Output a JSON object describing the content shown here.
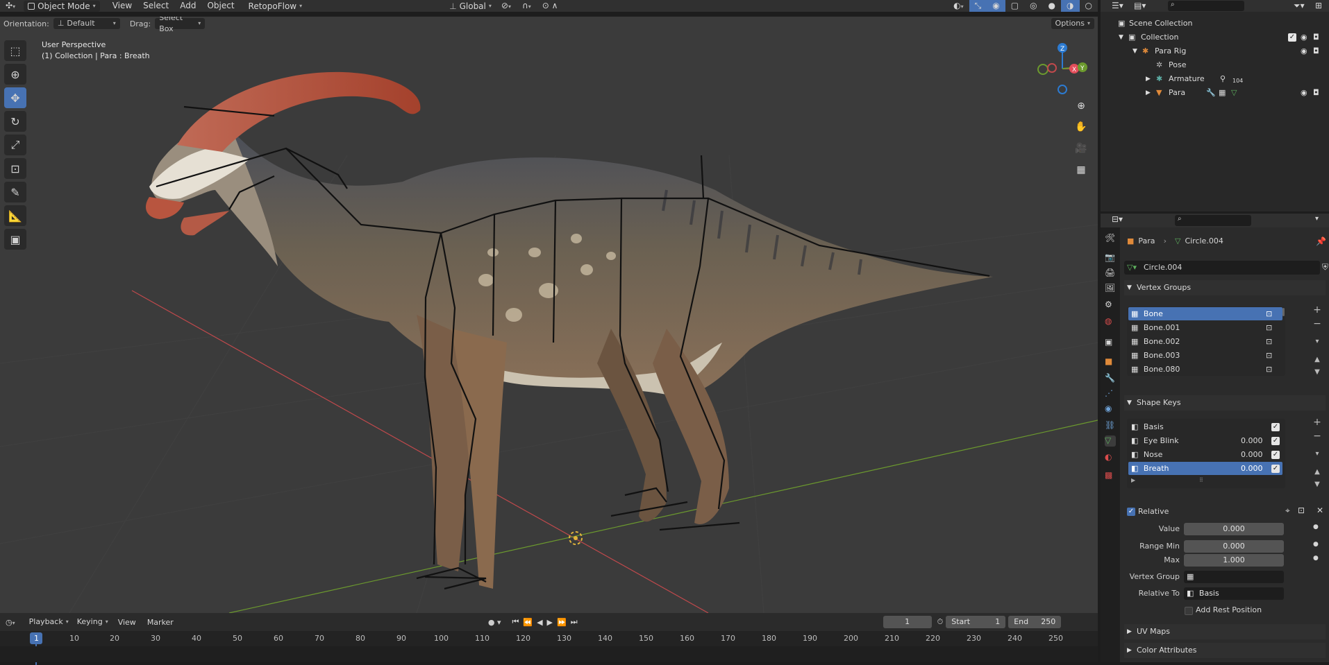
{
  "header": {
    "mode": "Object Mode",
    "menus": [
      "View",
      "Select",
      "Add",
      "Object",
      "RetopoFlow"
    ],
    "transform_orientation": "Global"
  },
  "tool_options": {
    "orientation_label": "Orientation:",
    "orientation_value": "Default",
    "drag_label": "Drag:",
    "drag_value": "Select Box",
    "options_label": "Options"
  },
  "viewport": {
    "perspective": "User Perspective",
    "collection_info": "(1) Collection | Para : Breath",
    "gizmo_axes": [
      "Z",
      "Y",
      "X"
    ],
    "colors": {
      "background": "#3b3b3b",
      "x_axis": "#c0494c",
      "y_axis": "#6c9a2e",
      "z_axis": "#2c7bd2"
    }
  },
  "toolbar": {
    "tools": [
      "select-box",
      "cursor",
      "move",
      "rotate",
      "scale",
      "transform",
      "annotate",
      "measure",
      "add-cube"
    ]
  },
  "timeline": {
    "menus": [
      "Playback",
      "Keying",
      "View",
      "Marker"
    ],
    "current_frame": "1",
    "start_label": "Start",
    "start_value": "1",
    "end_label": "End",
    "end_value": "250",
    "ruler_ticks": [
      "1",
      "10",
      "20",
      "30",
      "40",
      "50",
      "60",
      "70",
      "80",
      "90",
      "100",
      "110",
      "120",
      "130",
      "140",
      "150",
      "160",
      "170",
      "180",
      "190",
      "200",
      "210",
      "220",
      "230",
      "240",
      "250"
    ]
  },
  "outliner": {
    "items": [
      {
        "label": "Scene Collection"
      },
      {
        "label": "Collection"
      },
      {
        "label": "Para Rig"
      },
      {
        "label": "Pose"
      },
      {
        "label": "Armature",
        "badge": "104"
      },
      {
        "label": "Para"
      }
    ]
  },
  "properties": {
    "breadcrumb_object": "Para",
    "breadcrumb_data": "Circle.004",
    "data_name": "Circle.004",
    "vertex_groups": {
      "title": "Vertex Groups",
      "items": [
        "Bone",
        "Bone.001",
        "Bone.002",
        "Bone.003",
        "Bone.080"
      ]
    },
    "shape_keys": {
      "title": "Shape Keys",
      "items": [
        {
          "name": "Basis",
          "value": ""
        },
        {
          "name": "Eye Blink",
          "value": "0.000"
        },
        {
          "name": "Nose",
          "value": "0.000"
        },
        {
          "name": "Breath",
          "value": "0.000"
        }
      ]
    },
    "relative_label": "Relative",
    "value_label": "Value",
    "value": "0.000",
    "range_min_label": "Range Min",
    "range_min": "0.000",
    "max_label": "Max",
    "max": "1.000",
    "vertex_group_label": "Vertex Group",
    "vertex_group_value": "",
    "relative_to_label": "Relative To",
    "relative_to_value": "Basis",
    "add_rest_position_label": "Add Rest Position",
    "uv_maps_label": "UV Maps",
    "color_attributes_label": "Color Attributes"
  }
}
